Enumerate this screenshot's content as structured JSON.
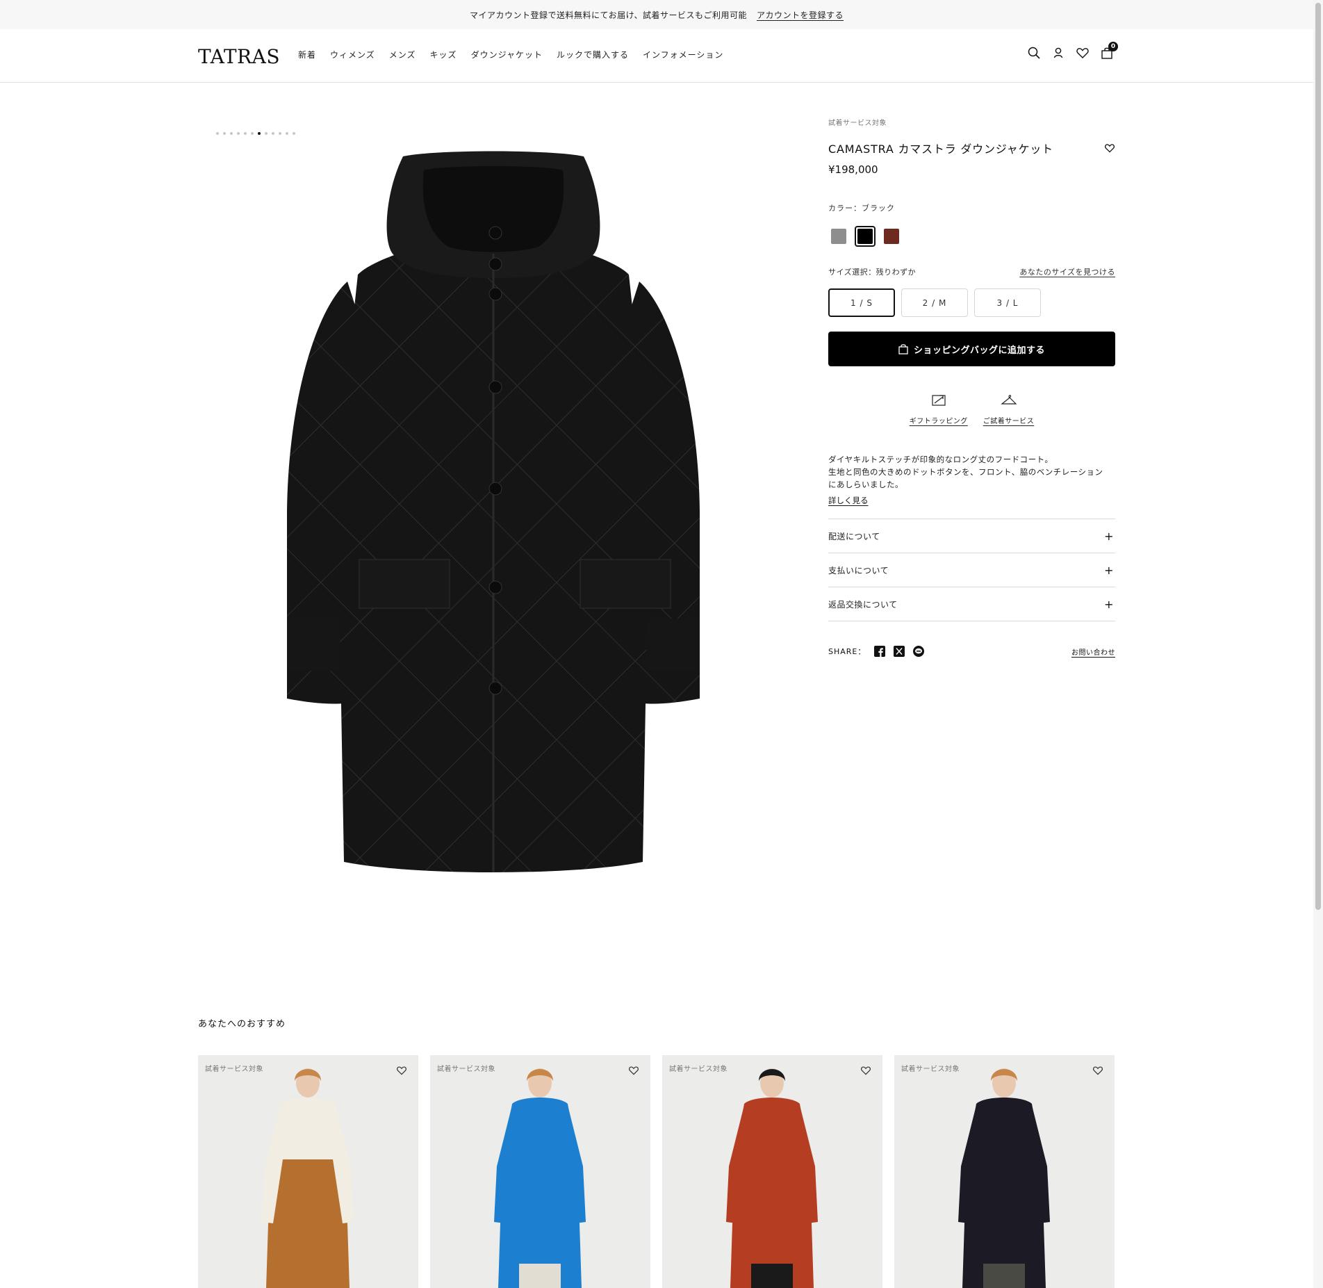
{
  "promo": {
    "text": "マイアカウント登録で送料無料にてお届け、試着サービスもご利用可能",
    "link": "アカウントを登録する"
  },
  "header": {
    "logo": "TATRAS",
    "nav": [
      "新着",
      "ウィメンズ",
      "メンズ",
      "キッズ",
      "ダウンジャケット",
      "ルックで購入する",
      "インフォメーション"
    ],
    "cart_count": "0",
    "icons": [
      "search-icon",
      "account-icon",
      "wishlist-icon",
      "cart-icon"
    ]
  },
  "gallery": {
    "dot_count": 12,
    "active_index": 6
  },
  "product": {
    "trial_tag": "試着サービス対象",
    "title": "CAMASTRA カマストラ ダウンジャケット",
    "price": "¥198,000",
    "color_label": "カラー：ブラック",
    "colors": [
      {
        "name": "grey",
        "hex": "#8e8e8e",
        "selected": false
      },
      {
        "name": "black",
        "hex": "#000000",
        "selected": true
      },
      {
        "name": "brown",
        "hex": "#6e2a1e",
        "selected": false
      }
    ],
    "size_label": "サイズ選択：残りわずか",
    "find_size": "あなたのサイズを見つける",
    "sizes": [
      {
        "label": "1 / S",
        "selected": true
      },
      {
        "label": "2 / M",
        "selected": false
      },
      {
        "label": "3 / L",
        "selected": false
      }
    ],
    "add_to_bag": "ショッピングバッグに追加する",
    "services": [
      {
        "label": "ギフトラッピング",
        "icon": "gift-wrap-icon"
      },
      {
        "label": "ご試着サービス",
        "icon": "hanger-icon"
      }
    ],
    "description_lines": [
      "ダイヤキルトステッチが印象的なロング丈のフードコート。",
      "生地と同色の大きめのドットボタンを、フロント、脇のベンチレーション",
      "にあしらいました。"
    ],
    "more": "詳しく見る",
    "accordion": [
      "配送について",
      "支払いについて",
      "返品交換について"
    ],
    "share_label": "SHARE：",
    "share_icons": [
      "facebook-icon",
      "x-icon",
      "line-icon"
    ],
    "contact": "お問い合わせ"
  },
  "recommendations": {
    "heading": "あなたへのおすすめ",
    "items": [
      {
        "tag": "試着サービス対象",
        "coat": "#b5702f",
        "top": "#f2ede2",
        "pants": "#b5702f"
      },
      {
        "tag": "試着サービス対象",
        "coat": "#1c7fd0",
        "top": "#1c7fd0",
        "pants": "#e2ddd3"
      },
      {
        "tag": "試着サービス対象",
        "coat": "#b53d22",
        "top": "#b53d22",
        "pants": "#1a1a1a"
      },
      {
        "tag": "試着サービス対象",
        "coat": "#1c1a24",
        "top": "#1c1a24",
        "pants": "#4a4a44"
      }
    ]
  }
}
